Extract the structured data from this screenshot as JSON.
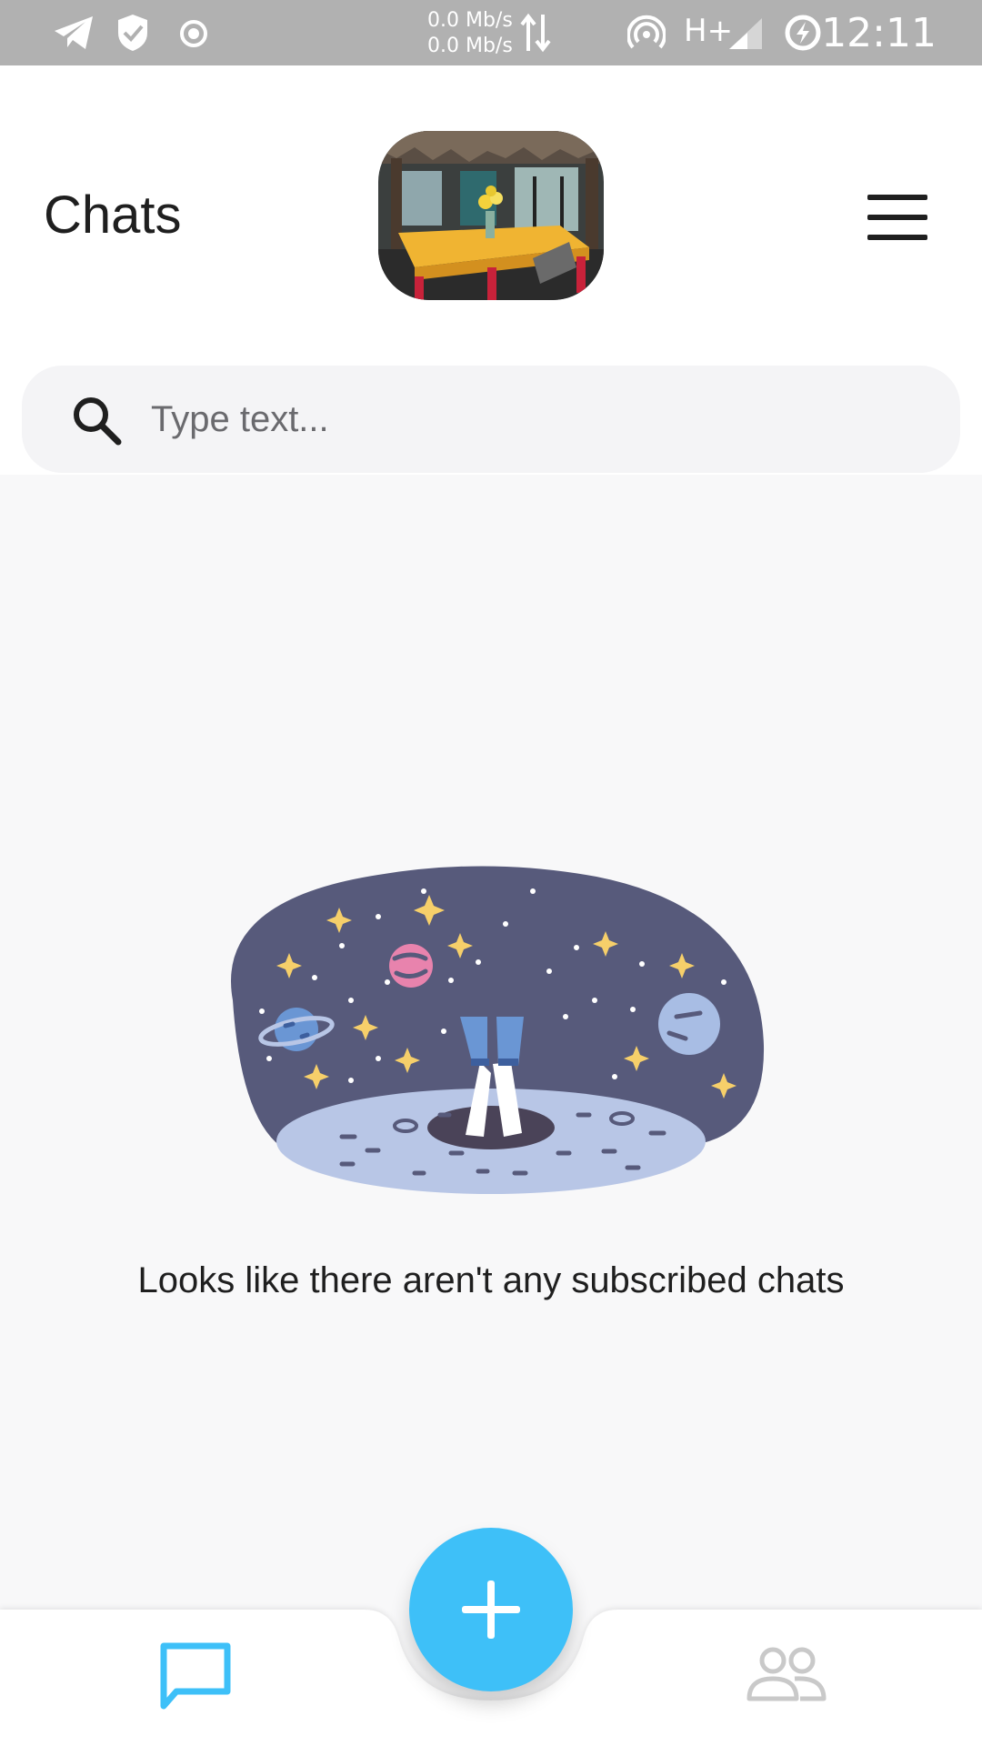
{
  "status_bar": {
    "net_up": "0.0 Mb/s",
    "net_down": "0.0 Mb/s",
    "network_type": "H+",
    "time": "12:11",
    "icons": [
      "telegram-icon",
      "shield-check-icon",
      "record-icon",
      "data-transfer-icon",
      "hotspot-icon",
      "signal-icon",
      "battery-charging-icon"
    ]
  },
  "header": {
    "title": "Chats",
    "logo": "venue-photo",
    "menu_icon": "hamburger-menu-icon"
  },
  "search": {
    "placeholder": "Type text...",
    "value": "",
    "icon": "search-icon"
  },
  "empty_state": {
    "illustration": "astronaut-in-space-illustration",
    "message": "Looks like there aren't any subscribed chats"
  },
  "bottom_nav": {
    "items": [
      {
        "icon": "chat-bubble-icon",
        "active": true
      },
      {
        "icon": "contacts-icon",
        "active": false
      }
    ],
    "fab_icon": "plus-icon"
  },
  "colors": {
    "accent": "#3ec0f8",
    "status_bar": "#b1b1b1",
    "background": "#f8f8f9",
    "space": "#575a7b",
    "ground": "#b8c6e6"
  }
}
